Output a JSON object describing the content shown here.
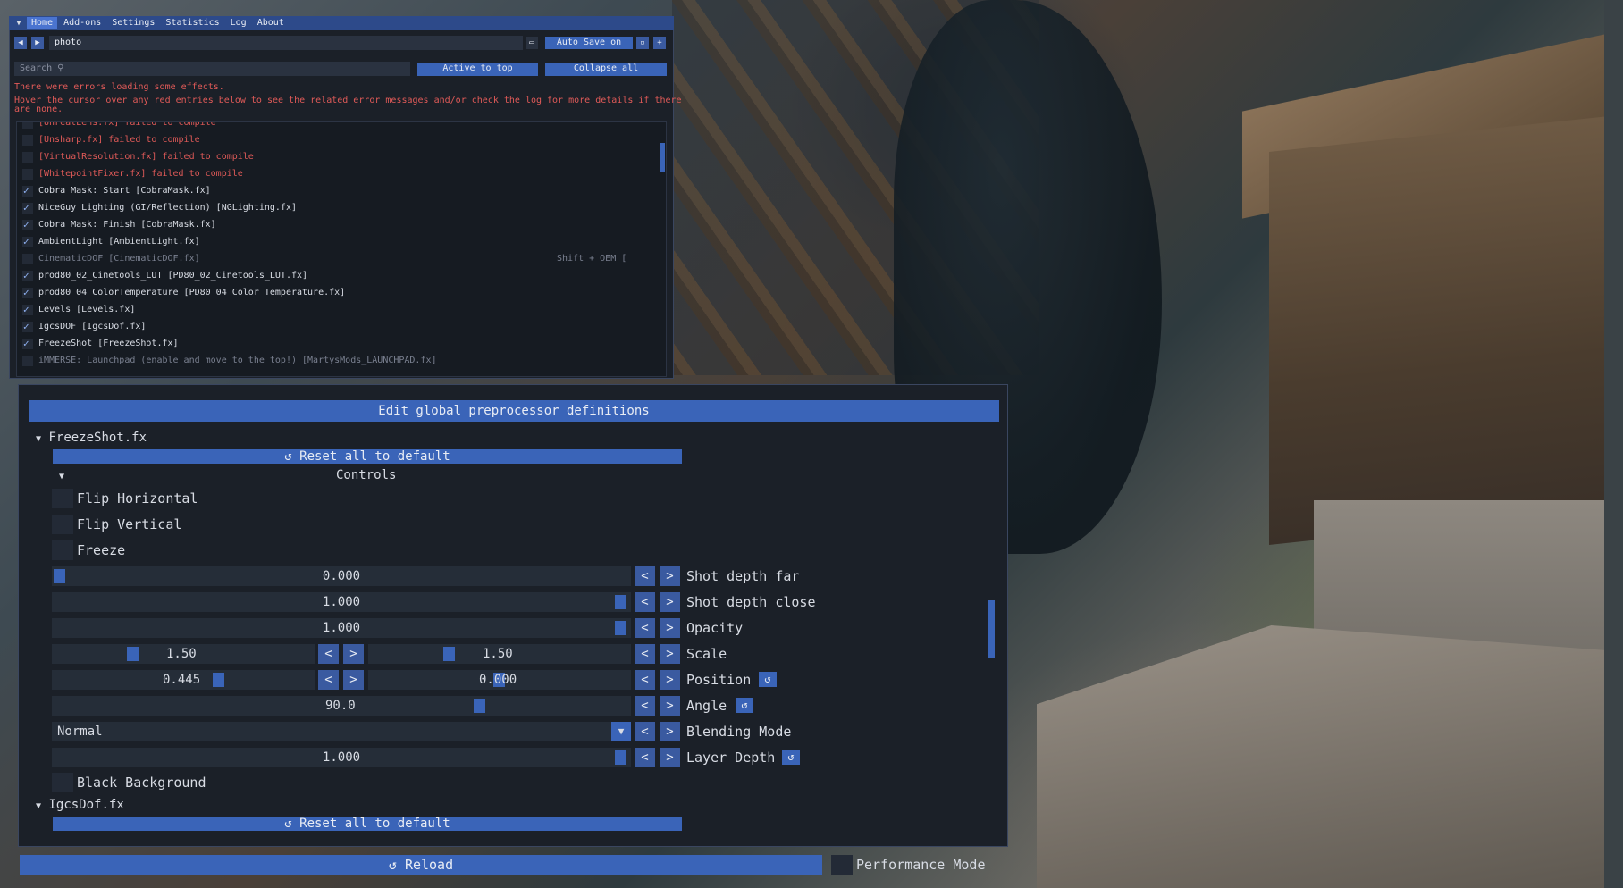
{
  "menu": {
    "tabs": [
      "Home",
      "Add-ons",
      "Settings",
      "Statistics",
      "Log",
      "About"
    ],
    "active": "Home"
  },
  "toolbar": {
    "preset": "photo",
    "autosave": "Auto Save on"
  },
  "search": {
    "placeholder": "Search"
  },
  "buttons": {
    "active_to_top": "Active to top",
    "collapse_all": "Collapse all"
  },
  "errors": {
    "line1": "There were errors loading some effects.",
    "line2": "Hover the cursor over any red entries below to see the related error messages and/or check the log for more details if there",
    "line3": "are none."
  },
  "effects": [
    {
      "label": "[UnrealLens.fx] failed to compile",
      "state": "error",
      "checked": false
    },
    {
      "label": "[Unsharp.fx] failed to compile",
      "state": "error",
      "checked": false
    },
    {
      "label": "[VirtualResolution.fx] failed to compile",
      "state": "error",
      "checked": false
    },
    {
      "label": "[WhitepointFixer.fx] failed to compile",
      "state": "error",
      "checked": false
    },
    {
      "label": "Cobra Mask: Start [CobraMask.fx]",
      "state": "ok",
      "checked": true
    },
    {
      "label": "NiceGuy Lighting (GI/Reflection) [NGLighting.fx]",
      "state": "ok",
      "checked": true
    },
    {
      "label": "Cobra Mask: Finish [CobraMask.fx]",
      "state": "ok",
      "checked": true
    },
    {
      "label": "AmbientLight [AmbientLight.fx]",
      "state": "ok",
      "checked": true
    },
    {
      "label": "CinematicDOF [CinematicDOF.fx]",
      "state": "disabled",
      "checked": false,
      "shortcut": "Shift + OEM ["
    },
    {
      "label": "prod80_02_Cinetools_LUT [PD80_02_Cinetools_LUT.fx]",
      "state": "ok",
      "checked": true
    },
    {
      "label": "prod80_04_ColorTemperature [PD80_04_Color_Temperature.fx]",
      "state": "ok",
      "checked": true
    },
    {
      "label": "Levels [Levels.fx]",
      "state": "ok",
      "checked": true
    },
    {
      "label": "IgcsDOF [IgcsDof.fx]",
      "state": "ok",
      "checked": true
    },
    {
      "label": "FreezeShot [FreezeShot.fx]",
      "state": "ok",
      "checked": true
    },
    {
      "label": "iMMERSE: Launchpad (enable and move to the top!) [MartysMods_LAUNCHPAD.fx]",
      "state": "disabled",
      "checked": false
    }
  ],
  "params": {
    "edit_global": "Edit global preprocessor definitions",
    "section1": "FreezeShot.fx",
    "reset": "Reset all to default",
    "controls": "Controls",
    "flip_h": "Flip Horizontal",
    "flip_v": "Flip Vertical",
    "freeze": "Freeze",
    "depth_far": {
      "label": "Shot depth far",
      "value": "0.000",
      "fraction": 0.0
    },
    "depth_close": {
      "label": "Shot depth close",
      "value": "1.000",
      "fraction": 1.0
    },
    "opacity": {
      "label": "Opacity",
      "value": "1.000",
      "fraction": 1.0
    },
    "scale": {
      "label": "Scale",
      "x": "1.50",
      "y": "1.50"
    },
    "position": {
      "label": "Position",
      "x": "0.445",
      "y": "0.000"
    },
    "angle": {
      "label": "Angle",
      "value": "90.0"
    },
    "blending": {
      "label": "Blending Mode",
      "value": "Normal"
    },
    "layer_depth": {
      "label": "Layer Depth",
      "value": "1.000"
    },
    "black_bg": "Black Background",
    "section2": "IgcsDof.fx"
  },
  "footer": {
    "reload": "Reload",
    "performance": "Performance Mode"
  },
  "icons": {
    "back": "◀",
    "forward": "▶",
    "prev": "<",
    "next": ">",
    "reset": "↺",
    "dropdown": "▼",
    "collapse": "▼",
    "search": "⚲",
    "plus": "+",
    "save": "▫",
    "folder": "▭",
    "menu": "▼"
  }
}
